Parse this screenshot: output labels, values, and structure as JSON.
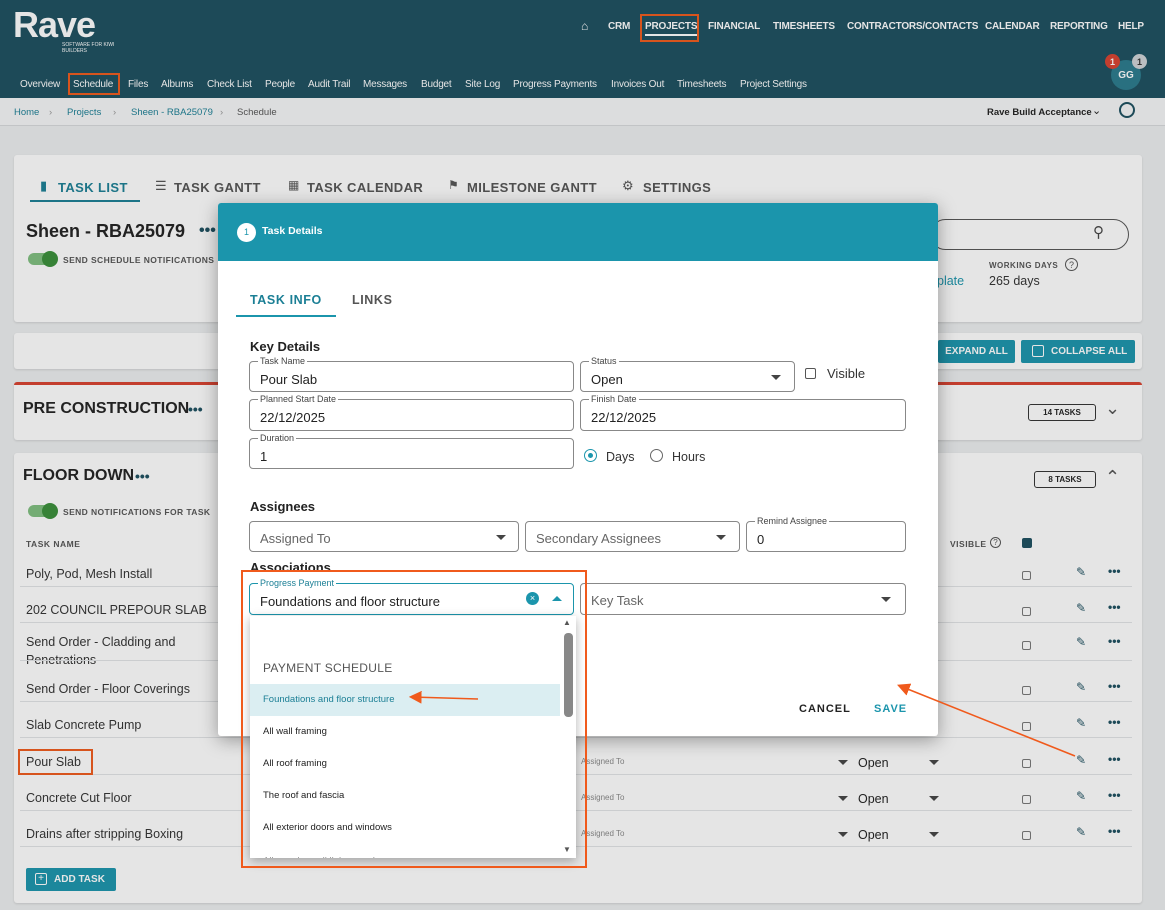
{
  "app": {
    "logo": "Rave",
    "logo_sub": "SOFTWARE FOR KIWI BUILDERS",
    "avatar": "GG",
    "badge_red": "1",
    "badge_grey": "1"
  },
  "topnav": [
    "CRM",
    "PROJECTS",
    "FINANCIAL",
    "TIMESHEETS",
    "CONTRACTORS/CONTACTS",
    "CALENDAR",
    "REPORTING",
    "HELP"
  ],
  "subnav": [
    "Overview",
    "Schedule",
    "Files",
    "Albums",
    "Check List",
    "People",
    "Audit Trail",
    "Messages",
    "Budget",
    "Site Log",
    "Progress Payments",
    "Invoices Out",
    "Timesheets",
    "Project Settings"
  ],
  "breadcrumb": [
    "Home",
    "Projects",
    "Sheen - RBA25079",
    "Schedule"
  ],
  "acceptance": "Rave Build Acceptance",
  "tabs": [
    "TASK LIST",
    "TASK GANTT",
    "TASK CALENDAR",
    "MILESTONE GANTT",
    "SETTINGS"
  ],
  "project": {
    "title": "Sheen - RBA25079",
    "send_notif": "SEND SCHEDULE NOTIFICATIONS",
    "template_link": "plate",
    "working_days_label": "WORKING DAYS",
    "working_days": "265 days"
  },
  "toolbar": {
    "expand": "EXPAND ALL",
    "collapse": "COLLAPSE ALL"
  },
  "groups": [
    {
      "name": "PRE CONSTRUCTION",
      "count": "14 TASKS"
    },
    {
      "name": "FLOOR DOWN",
      "count": "8 TASKS",
      "send_notif": "SEND NOTIFICATIONS FOR TASK",
      "col_task": "TASK NAME",
      "col_visible": "VISIBLE"
    }
  ],
  "tasks": [
    {
      "name": "Poly, Pod, Mesh Install"
    },
    {
      "name": "202 COUNCIL PREPOUR SLAB"
    },
    {
      "name": "Send Order - Cladding and Penetrations"
    },
    {
      "name": "Send Order - Floor Coverings"
    },
    {
      "name": "Slab Concrete Pump"
    },
    {
      "name": "Pour Slab",
      "assigned": "Assigned To",
      "status": "Open"
    },
    {
      "name": "Concrete Cut Floor",
      "assigned": "Assigned To",
      "status": "Open"
    },
    {
      "name": "Drains after stripping Boxing",
      "assigned": "Assigned To",
      "status": "Open"
    }
  ],
  "add_task": "ADD TASK",
  "modal": {
    "step": "1",
    "title": "Task Details",
    "tabs": [
      "TASK INFO",
      "LINKS"
    ],
    "key_details": "Key Details",
    "task_name": {
      "label": "Task Name",
      "value": "Pour Slab"
    },
    "status": {
      "label": "Status",
      "value": "Open"
    },
    "visible": "Visible",
    "start": {
      "label": "Planned Start Date",
      "value": "22/12/2025"
    },
    "finish": {
      "label": "Finish Date",
      "value": "22/12/2025"
    },
    "duration": {
      "label": "Duration",
      "value": "1"
    },
    "days": "Days",
    "hours": "Hours",
    "assignees": "Assignees",
    "assigned_to": "Assigned To",
    "secondary": "Secondary Assignees",
    "remind": {
      "label": "Remind Assignee",
      "value": "0"
    },
    "associations": "Associations",
    "progress_payment": {
      "label": "Progress Payment",
      "value": "Foundations and floor structure"
    },
    "key_task": "Key Task",
    "cancel": "CANCEL",
    "save": "SAVE"
  },
  "dropdown": {
    "group": "PAYMENT SCHEDULE",
    "items": [
      "Foundations and floor structure",
      "All wall framing",
      "All roof framing",
      "The roof and fascia",
      "All exterior doors and windows",
      "All exterior wall linings and"
    ]
  },
  "colors": {
    "header": "#1c4f5f",
    "accent": "#1b95ac",
    "annotation": "#f05a1c"
  }
}
